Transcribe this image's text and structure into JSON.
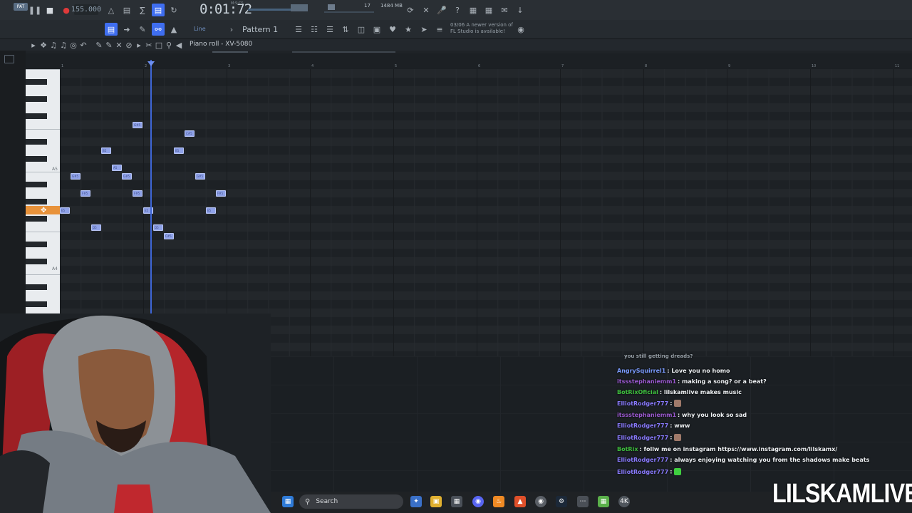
{
  "transport": {
    "pat_label": "PAT",
    "tempo": "155.000",
    "time": "0:01:72",
    "time_unit": "M:S:CS",
    "cpu": "17",
    "memory": "1484 MB"
  },
  "toolbar": {
    "pattern_label": "Pattern 1",
    "snap_label": "Line",
    "notice_line1": "03/06  A newer version of",
    "notice_line2": "FL Studio is available!"
  },
  "piano_roll": {
    "title": "Piano roll - XV-5080",
    "bar_numbers": [
      "1",
      "2",
      "3",
      "4",
      "5",
      "6",
      "7",
      "8",
      "9",
      "10",
      "11"
    ],
    "octave_labels": [
      {
        "label": "A5"
      },
      {
        "label": "A4"
      }
    ]
  },
  "notes": [
    {
      "label": "G#5"
    },
    {
      "label": "C#5"
    },
    {
      "label": "B5"
    },
    {
      "label": "B5"
    },
    {
      "label": "A5"
    },
    {
      "label": "G#5"
    },
    {
      "label": "G#5"
    },
    {
      "label": "G#5"
    },
    {
      "label": "F#5"
    },
    {
      "label": "F#5"
    },
    {
      "label": "F#5"
    },
    {
      "label": "E5"
    },
    {
      "label": "E5"
    },
    {
      "label": "E5"
    },
    {
      "label": "D5"
    },
    {
      "label": "D5"
    },
    {
      "label": "C#5"
    }
  ],
  "chat": [
    {
      "user": "AngrySquirrel1",
      "user_color": "#7b9cff",
      "message": ": Love you no homo"
    },
    {
      "user": "itssstephaniemm1",
      "user_color": "#9b59d0",
      "message": ": making a song? or a beat?"
    },
    {
      "user": "BotRixOficial",
      "user_color": "#3fbf3f",
      "message": ": lilskamlive makes music"
    },
    {
      "user": "ElliotRodger777",
      "user_color": "#8a7bff",
      "message": ": "
    },
    {
      "user": "itssstephaniemm1",
      "user_color": "#9b59d0",
      "message": ": why you look so sad"
    },
    {
      "user": "ElliotRodger777",
      "user_color": "#8a7bff",
      "message": ": www"
    },
    {
      "user": "ElliotRodger777",
      "user_color": "#8a7bff",
      "message": ": "
    },
    {
      "user": "BotRix",
      "user_color": "#3fbf3f",
      "message": ": follw me on instagram https://www.instagram.com/lilskamx/"
    },
    {
      "user": "ElliotRodger777",
      "user_color": "#8a7bff",
      "message": ": always enjoying watching you from the shadows make beats"
    },
    {
      "user": "ElliotRodger777",
      "user_color": "#8a7bff",
      "message": ": "
    }
  ],
  "chat_partial_top": "you still getting dreads?",
  "taskbar": {
    "search_placeholder": "Search"
  },
  "watermark": "LILSKAMLIVE",
  "colors": {
    "accent": "#3f6ef0",
    "note": "#8fa2e8",
    "highlight_key": "#e8923a"
  }
}
